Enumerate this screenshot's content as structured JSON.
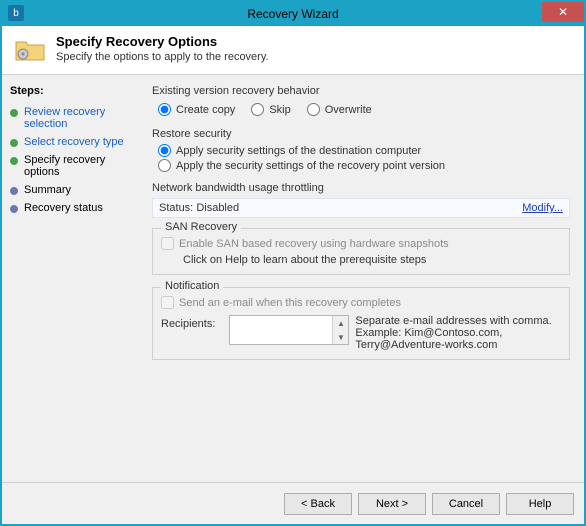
{
  "window": {
    "title": "Recovery Wizard",
    "icon_letter": "b"
  },
  "header": {
    "title": "Specify Recovery Options",
    "subtitle": "Specify the options to apply to the recovery."
  },
  "sidebar": {
    "title": "Steps:",
    "items": [
      {
        "label": "Review recovery selection",
        "state": "done"
      },
      {
        "label": "Select recovery type",
        "state": "done"
      },
      {
        "label": "Specify recovery options",
        "state": "current"
      },
      {
        "label": "Summary",
        "state": "future"
      },
      {
        "label": "Recovery status",
        "state": "future"
      }
    ]
  },
  "version_behavior": {
    "title": "Existing version recovery behavior",
    "options": {
      "create_copy": "Create copy",
      "skip": "Skip",
      "overwrite": "Overwrite"
    },
    "selected": "create_copy"
  },
  "restore_security": {
    "title": "Restore security",
    "options": {
      "dest": "Apply security settings of the destination computer",
      "rp": "Apply the security settings of the recovery point version"
    },
    "selected": "dest"
  },
  "throttling": {
    "title": "Network bandwidth usage throttling",
    "status_label": "Status:",
    "status_value": "Disabled",
    "modify": "Modify..."
  },
  "san": {
    "title": "SAN Recovery",
    "checkbox": "Enable SAN based recovery using hardware snapshots",
    "hint": "Click on Help to learn about the prerequisite steps"
  },
  "notification": {
    "title": "Notification",
    "checkbox": "Send an e-mail when this recovery completes",
    "recipients_label": "Recipients:",
    "hint_line1": "Separate e-mail addresses with comma.",
    "hint_line2": "Example: Kim@Contoso.com, Terry@Adventure-works.com"
  },
  "footer": {
    "back": "< Back",
    "next": "Next >",
    "cancel": "Cancel",
    "help": "Help"
  }
}
